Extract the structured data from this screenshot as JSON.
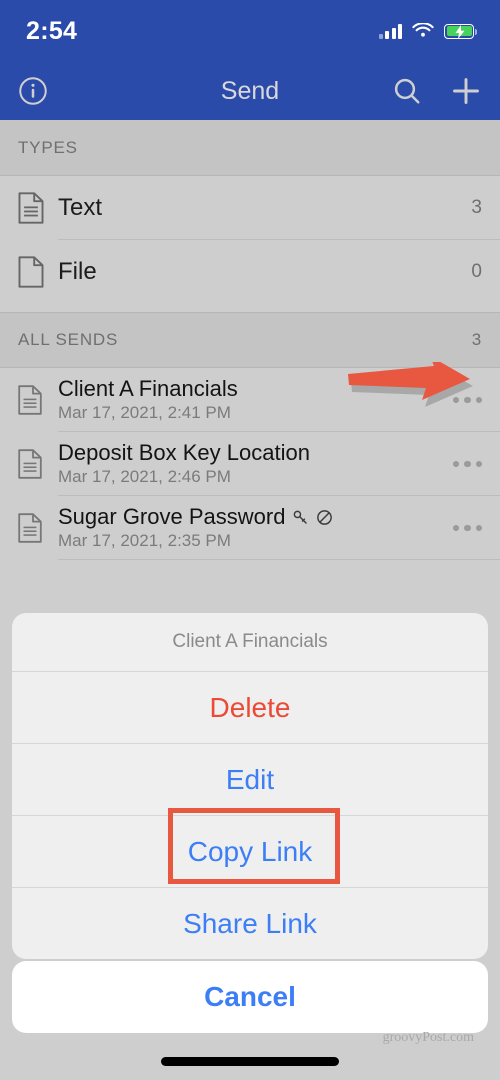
{
  "status_bar": {
    "time": "2:54",
    "signal_icon": "cellular-signal-icon",
    "wifi_icon": "wifi-icon",
    "battery_icon": "battery-charging-icon"
  },
  "nav_bar": {
    "title": "Send",
    "info_icon": "info-circle-icon",
    "search_icon": "search-icon",
    "add_icon": "plus-icon",
    "background_color": "#2B4BAB",
    "title_color": "#d9d9d9"
  },
  "sections": [
    {
      "header": "TYPES",
      "header_count": "",
      "rows": [
        {
          "icon": "text-document-icon",
          "label": "Text",
          "count": "3"
        },
        {
          "icon": "blank-file-icon",
          "label": "File",
          "count": "0"
        }
      ]
    },
    {
      "header": "ALL SENDS",
      "header_count": "3",
      "sends": [
        {
          "icon": "text-document-icon",
          "title": "Client A Financials",
          "date": "Mar 17, 2021, 2:41 PM",
          "badges": [],
          "more_icon": "more-options-icon"
        },
        {
          "icon": "text-document-icon",
          "title": "Deposit Box Key Location",
          "date": "Mar 17, 2021, 2:46 PM",
          "badges": [],
          "more_icon": "more-options-icon"
        },
        {
          "icon": "text-document-icon",
          "title": "Sugar Grove Password",
          "date": "Mar 17, 2021, 2:35 PM",
          "badges": [
            "key-icon",
            "disabled-circle-slash-icon"
          ],
          "more_icon": "more-options-icon"
        }
      ]
    }
  ],
  "action_sheet": {
    "title": "Client A Financials",
    "items": [
      {
        "label": "Delete",
        "style": "destructive"
      },
      {
        "label": "Edit",
        "style": "normal"
      },
      {
        "label": "Copy Link",
        "style": "normal",
        "highlighted": true
      },
      {
        "label": "Share Link",
        "style": "normal"
      }
    ],
    "cancel_label": "Cancel"
  },
  "annotations": {
    "arrow_icon": "red-arrow-right-icon",
    "arrow_color": "#E8573F",
    "highlight_color": "#E8573F",
    "destructive_color": "#EB4A36",
    "link_color": "#3C7EF6"
  },
  "watermark": {
    "text": "groovyPost.com"
  }
}
